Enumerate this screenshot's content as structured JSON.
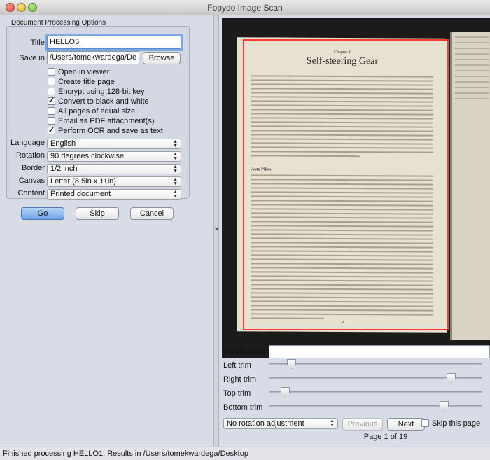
{
  "window": {
    "title": "Fopydo Image Scan"
  },
  "options": {
    "group_title": "Document Processing Options",
    "title_label": "Title",
    "title_value": "HELLO5",
    "save_in_label": "Save in",
    "save_in_value": "/Users/tomekwardega/De",
    "browse_label": "Browse",
    "checkboxes": [
      {
        "label": "Open in viewer",
        "checked": false
      },
      {
        "label": "Create title page",
        "checked": false
      },
      {
        "label": "Encrypt using 128-bit key",
        "checked": false
      },
      {
        "label": "Convert to black and white",
        "checked": true
      },
      {
        "label": "All pages of equal size",
        "checked": false
      },
      {
        "label": "Email as PDF attachment(s)",
        "checked": false
      },
      {
        "label": "Perform OCR and save as text",
        "checked": true
      }
    ],
    "language_label": "Language",
    "language_value": "English",
    "rotation_label": "Rotation",
    "rotation_value": "90 degrees clockwise",
    "border_label": "Border",
    "border_value": "1/2 inch",
    "canvas_label": "Canvas",
    "canvas_value": "Letter (8.5in x 11in)",
    "content_label": "Content",
    "content_value": "Printed document"
  },
  "actions": {
    "go": "Go",
    "skip": "Skip",
    "cancel": "Cancel"
  },
  "preview": {
    "chapter": "Chapter 4",
    "heading": "Self-steering Gear",
    "subhead": "Auto Pilots",
    "page_number": "24"
  },
  "adjust": {
    "border_label_label": "Border label",
    "border_label_value": "",
    "left_trim_label": "Left trim",
    "left_trim_value": 0.1,
    "right_trim_label": "Right trim",
    "right_trim_value": 0.87,
    "top_trim_label": "Top trim",
    "top_trim_value": 0.08,
    "bottom_trim_label": "Bottom trim",
    "bottom_trim_value": 0.84,
    "rotation_adjust_value": "No rotation adjustment",
    "previous_label": "Previous",
    "next_label": "Next",
    "skip_page_label": "Skip this page",
    "page_indicator": "Page 1 of 19"
  },
  "status": {
    "text": "Finished processing HELLO1: Results in /Users/tomekwardega/Desktop"
  }
}
